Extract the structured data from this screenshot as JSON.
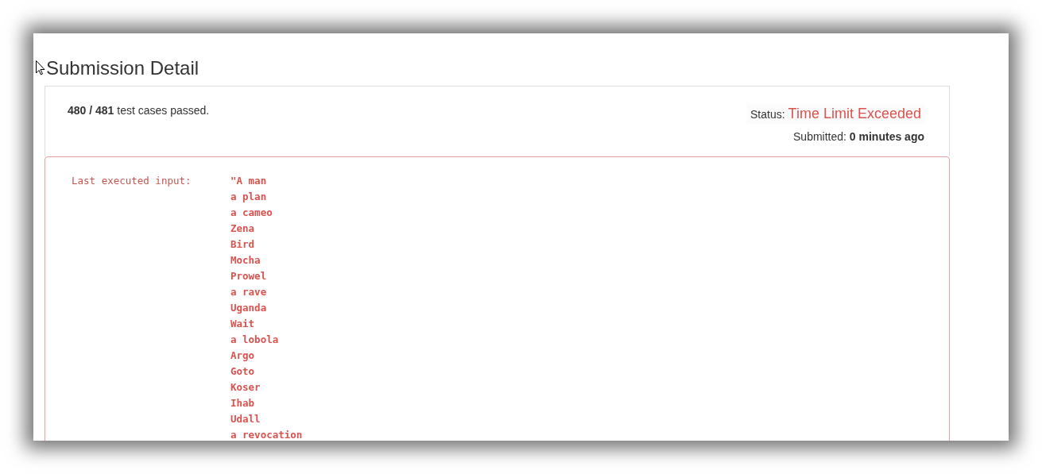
{
  "title": "Submission Detail",
  "result": {
    "passed": "**480 / 481** test cases passed.",
    "status_label": "Status:",
    "status": "Time Limit Exceeded",
    "submitted": "Submitted: **0 minutes ago**"
  },
  "error": {
    "label": "Last executed input:",
    "lines": [
      "\"A man",
      "a plan",
      "a cameo",
      "Zena",
      "Bird",
      "Mocha",
      "Prowel",
      "a rave",
      "Uganda",
      "Wait",
      "a lobola",
      "Argo",
      "Goto",
      "Koser",
      "Ihab",
      "Udall",
      "a revocation"
    ]
  }
}
